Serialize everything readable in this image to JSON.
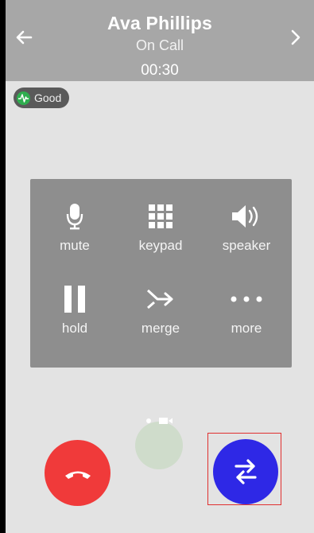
{
  "header": {
    "caller_name": "Ava Phillips",
    "status": "On Call",
    "timer": "00:30",
    "back_icon": "arrow-left-icon",
    "next_icon": "chevron-right-icon"
  },
  "quality": {
    "label": "Good",
    "color": "#2fae4f"
  },
  "controls": [
    {
      "label": "mute",
      "icon": "microphone-icon"
    },
    {
      "label": "keypad",
      "icon": "keypad-icon"
    },
    {
      "label": "speaker",
      "icon": "speaker-icon"
    },
    {
      "label": "hold",
      "icon": "pause-icon"
    },
    {
      "label": "merge",
      "icon": "merge-icon"
    },
    {
      "label": "more",
      "icon": "more-icon"
    }
  ],
  "actions": {
    "end_call_color": "#f03a3a",
    "transfer_color": "#2e28e6"
  }
}
